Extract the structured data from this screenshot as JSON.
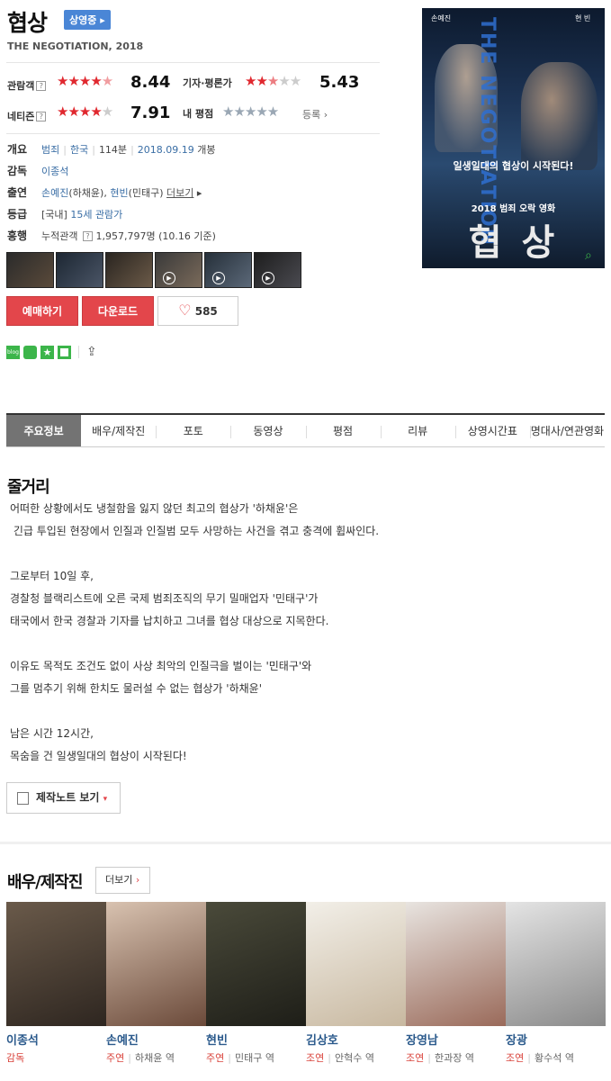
{
  "movie": {
    "title": "협상",
    "status_badge": "상영중",
    "en_title": "THE NEGOTIATION, 2018"
  },
  "ratings": {
    "audience": {
      "label": "관람객",
      "score": "8.44",
      "stars": 4.2
    },
    "critic": {
      "label": "기자·평론가",
      "score": "5.43",
      "stars": 2.7
    },
    "netizen": {
      "label": "네티즌",
      "score": "7.91",
      "stars": 4.0
    },
    "mine": {
      "label": "내 평점",
      "register": "등록"
    }
  },
  "info": {
    "overview_label": "개요",
    "genre": "범죄",
    "country": "한국",
    "runtime": "114분",
    "release": "2018.09.19",
    "release_suffix": " 개봉",
    "director_label": "감독",
    "director": "이종석",
    "cast_label": "출연",
    "cast1": "손예진",
    "cast1_role": "(하채윤)",
    "cast2": "현빈",
    "cast2_role": "(민태구)",
    "more_cast": "더보기",
    "grade_label": "등급",
    "grade_prefix": "[국내]",
    "grade": "15세 관람가",
    "box_label": "흥행",
    "box_prefix": "누적관객",
    "box_value": "1,957,797명 (10.16 기준)"
  },
  "poster": {
    "actor_left": "손예진",
    "actor_right": "현 빈",
    "vertical_title": "THE NEGOTIATION",
    "tagline": "일생일대의 협상이 시작된다!",
    "subtitle": "2018 범죄 오락 영화",
    "big_title": "협 상"
  },
  "buttons": {
    "reserve": "예매하기",
    "download": "다운로드",
    "likes": "585"
  },
  "tabs": [
    "주요정보",
    "배우/제작진",
    "포토",
    "동영상",
    "평점",
    "리뷰",
    "상영시간표",
    "명대사/연관영화"
  ],
  "synopsis": {
    "title": "줄거리",
    "lines": [
      "어떠한 상황에서도 냉철함을 잃지 않던 최고의 협상가 '하채윤'은",
      " 긴급 투입된 현장에서 인질과 인질범 모두 사망하는 사건을 겪고 충격에 휩싸인다.",
      "",
      "그로부터 10일 후,",
      "경찰청 블랙리스트에 오른 국제 범죄조직의 무기 밀매업자 '민태구'가",
      "태국에서 한국 경찰과 기자를 납치하고 그녀를 협상 대상으로 지목한다.",
      "",
      "이유도 목적도 조건도 없이 사상 최악의 인질극을 벌이는 '민태구'와",
      "그를 멈추기 위해 한치도 물러설 수 없는 협상가 '하채윤'",
      "",
      "남은 시간 12시간,",
      "목숨을 건 일생일대의 협상이 시작된다!"
    ],
    "note_button": "제작노트 보기"
  },
  "cast_section": {
    "title": "배우/제작진",
    "more": "더보기",
    "people": [
      {
        "name": "이종석",
        "role": "감독",
        "character": ""
      },
      {
        "name": "손예진",
        "role": "주연",
        "character": "하채윤 역"
      },
      {
        "name": "현빈",
        "role": "주연",
        "character": "민태구 역"
      },
      {
        "name": "김상호",
        "role": "조연",
        "character": "안혁수 역"
      },
      {
        "name": "장영남",
        "role": "조연",
        "character": "한과장 역"
      },
      {
        "name": "장광",
        "role": "조연",
        "character": "황수석 역"
      }
    ]
  },
  "colors": {
    "accent_red": "#e3464b",
    "link_blue": "#3a6ea5",
    "badge_blue": "#4a86d6"
  }
}
